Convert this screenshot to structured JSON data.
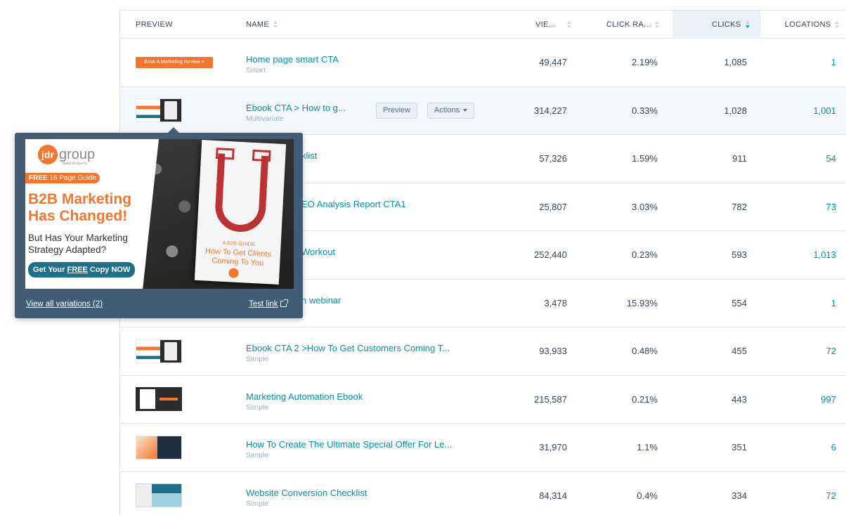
{
  "headers": {
    "preview": "PREVIEW",
    "name": "NAME",
    "views": "VIE...",
    "click_rate": "CLICK RA...",
    "clicks": "CLICKS",
    "locations": "LOCATIONS"
  },
  "colors": {
    "link": "#0091ae",
    "accent": "#f2762e",
    "popover": "#425b76"
  },
  "rows": [
    {
      "name": "Home page smart CTA",
      "type": "Smart",
      "views": "49,447",
      "rate": "2.19%",
      "clicks": "1,085",
      "locations": "1",
      "thumb_text": "Book A Marketing Review >"
    },
    {
      "name": "Ebook CTA > How to g...",
      "type": "Multivariate",
      "views": "314,227",
      "rate": "0.33%",
      "clicks": "1,028",
      "locations": "1,001"
    },
    {
      "name": "klist",
      "type": "",
      "views": "57,326",
      "rate": "1.59%",
      "clicks": "911",
      "locations": "54"
    },
    {
      "name": "EO Analysis Report CTA1",
      "type": "",
      "views": "25,807",
      "rate": "3.03%",
      "clicks": "782",
      "locations": "73"
    },
    {
      "name": "Workout",
      "type": "",
      "views": "252,440",
      "rate": "0.23%",
      "clicks": "593",
      "locations": "1,013"
    },
    {
      "name": "n webinar",
      "type": "",
      "views": "3,478",
      "rate": "15.93%",
      "clicks": "554",
      "locations": "1"
    },
    {
      "name": "Ebook CTA 2 >How To Get Customers Coming T...",
      "type": "Simple",
      "views": "93,933",
      "rate": "0.48%",
      "clicks": "455",
      "locations": "72"
    },
    {
      "name": "Marketing Automation Ebook",
      "type": "Simple",
      "views": "215,587",
      "rate": "0.21%",
      "clicks": "443",
      "locations": "997"
    },
    {
      "name": "How To Create The Ultimate Special Offer For Le...",
      "type": "Simple",
      "views": "31,970",
      "rate": "1.1%",
      "clicks": "351",
      "locations": "6"
    },
    {
      "name": "Website Conversion Checklist",
      "type": "Simple",
      "views": "84,314",
      "rate": "0.4%",
      "clicks": "334",
      "locations": "72"
    }
  ],
  "row_actions": {
    "preview": "Preview",
    "actions": "Actions"
  },
  "popover": {
    "logo_letters": "jdr",
    "logo_word": "group",
    "logo_tagline": "digital prosperity",
    "free_bold": "FREE",
    "free_rest": " 16 Page Guide",
    "headline_1": "B2B Marketing",
    "headline_2": "Has Changed!",
    "subhead_1": "But Has Your Marketing",
    "subhead_2": "Strategy Adapted?",
    "cta_pre": "Get Your ",
    "cta_free": "FREE",
    "cta_post": " Copy NOW",
    "book_tag": "A B2B GUIDE",
    "book_title": "How To Get Clients Coming To You",
    "view_all": "View all variations (2)",
    "test_link": "Test link"
  }
}
